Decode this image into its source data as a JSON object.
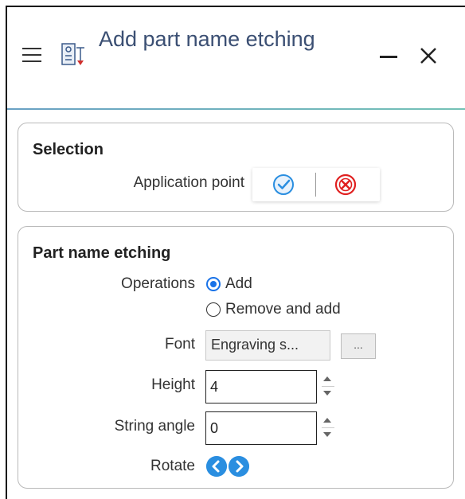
{
  "window": {
    "title": "Add part name etching",
    "icons": {
      "menu": "hamburger-menu-icon",
      "app": "etching-tool-icon",
      "minimize": "minimize-icon",
      "close": "close-icon"
    }
  },
  "selection": {
    "title": "Selection",
    "application_point_label": "Application point",
    "accept_icon": "check-circle-icon",
    "cancel_icon": "cancel-circle-icon",
    "colors": {
      "accept": "#2a8ee0",
      "cancel": "#e02020"
    }
  },
  "etching": {
    "title": "Part name etching",
    "operations_label": "Operations",
    "operations": [
      {
        "label": "Add",
        "selected": true
      },
      {
        "label": "Remove and add",
        "selected": false
      }
    ],
    "font_label": "Font",
    "font_value": "Engraving s...",
    "browse_label": "...",
    "height_label": "Height",
    "height_value": "4",
    "angle_label": "String angle",
    "angle_value": "0",
    "rotate_label": "Rotate",
    "rotate_left_icon": "chevron-left-circle-icon",
    "rotate_right_icon": "chevron-right-circle-icon"
  },
  "colors": {
    "title": "#3b4f73",
    "accent": "#2a8ee0",
    "divider": "#6aa1c4"
  }
}
